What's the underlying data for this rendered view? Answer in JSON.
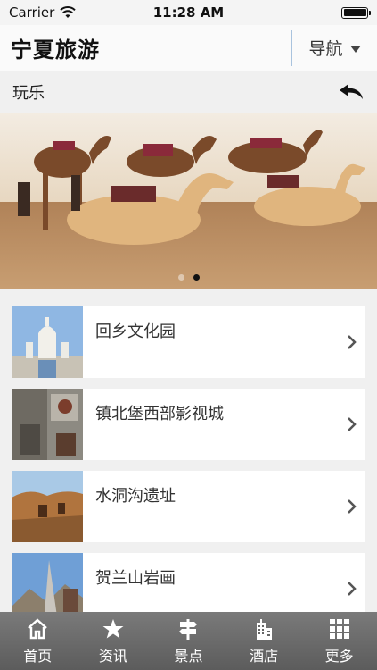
{
  "status_bar": {
    "carrier": "Carrier",
    "time": "11:28 AM"
  },
  "header": {
    "logo": "宁夏旅游",
    "nav_label": "导航"
  },
  "section": {
    "title": "玩乐"
  },
  "banner": {
    "slide_count": 2,
    "active_slide": 2
  },
  "list": {
    "items": [
      {
        "title": "回乡文化园"
      },
      {
        "title": "镇北堡西部影视城"
      },
      {
        "title": "水洞沟遗址"
      },
      {
        "title": "贺兰山岩画"
      }
    ]
  },
  "tabbar": {
    "tabs": [
      {
        "label": "首页",
        "icon": "home-icon"
      },
      {
        "label": "资讯",
        "icon": "star-icon"
      },
      {
        "label": "景点",
        "icon": "signpost-icon"
      },
      {
        "label": "酒店",
        "icon": "building-icon"
      },
      {
        "label": "更多",
        "icon": "grid-icon"
      }
    ]
  }
}
